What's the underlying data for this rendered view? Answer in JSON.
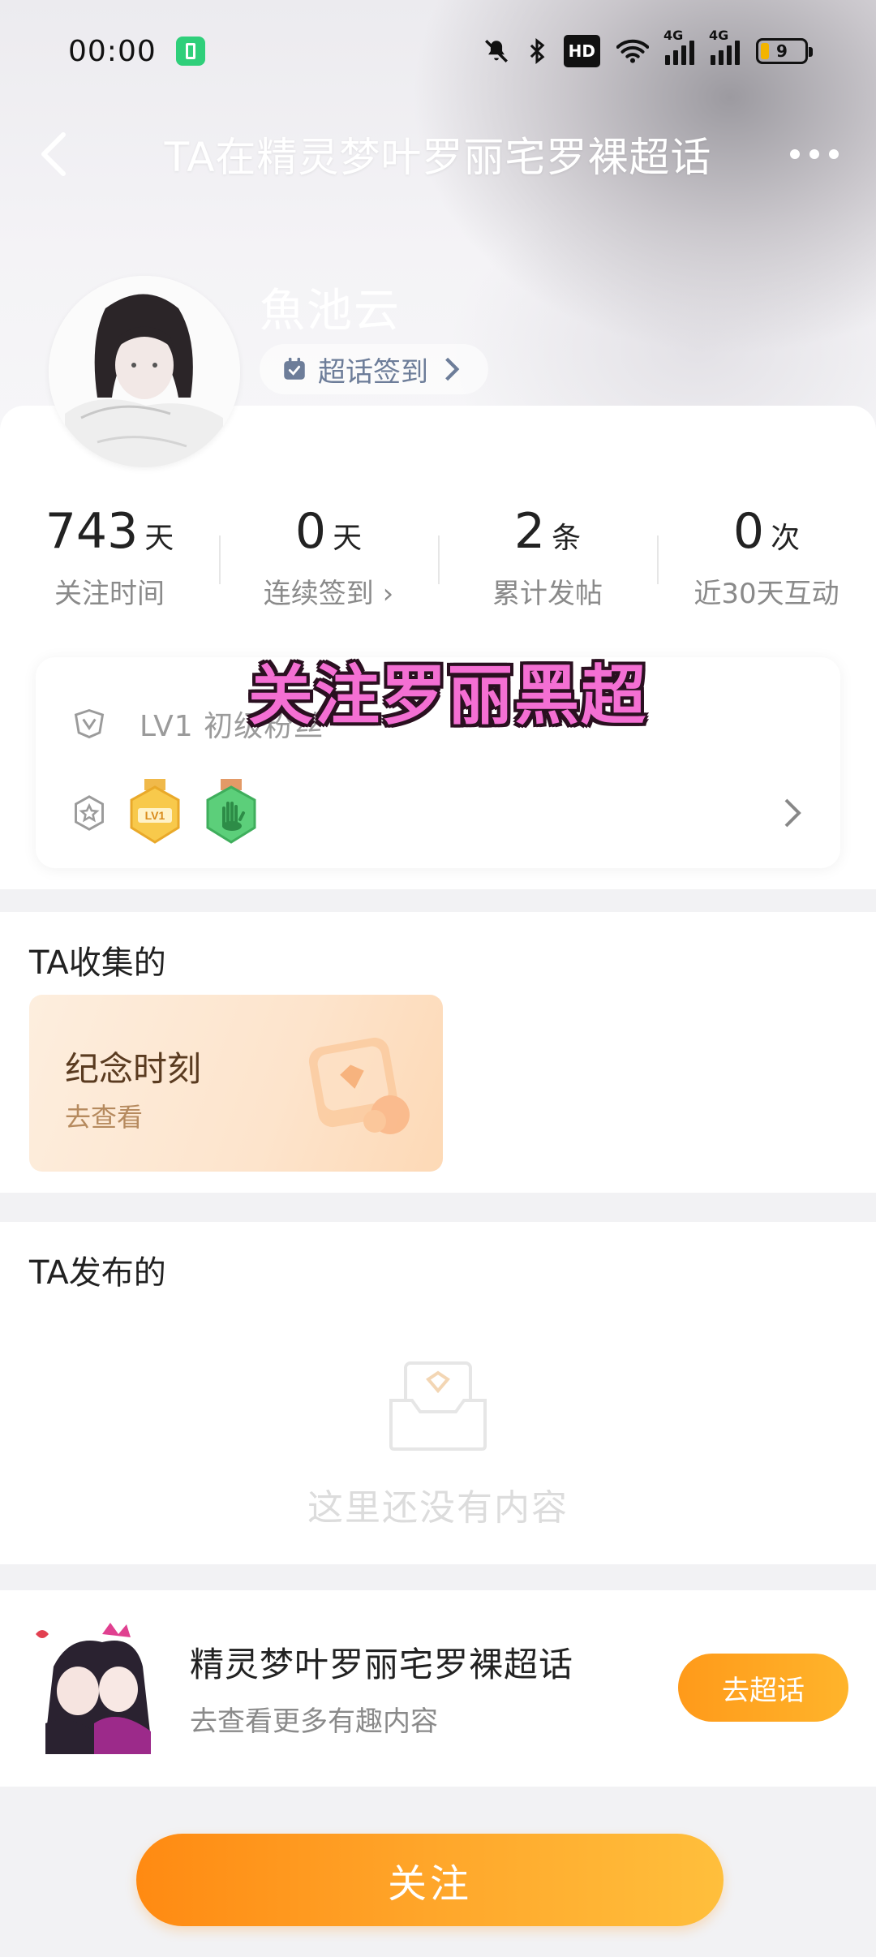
{
  "status_bar": {
    "time": "00:00",
    "hd_label": "HD",
    "network_1": "4G",
    "network_2": "4G",
    "battery_level": "9"
  },
  "nav": {
    "title": "TA在精灵梦叶罗丽宅罗裸超话"
  },
  "profile": {
    "username": "魚池云",
    "checkin_label": "超话签到"
  },
  "stats": [
    {
      "value": "743",
      "unit": "天",
      "label": "关注时间"
    },
    {
      "value": "0",
      "unit": "天",
      "label": "连续签到 ›"
    },
    {
      "value": "2",
      "unit": "条",
      "label": "累计发帖"
    },
    {
      "value": "0",
      "unit": "次",
      "label": "近30天互动"
    }
  ],
  "level": {
    "text": "LV1 初级粉丝",
    "badge_1_text": "LV1"
  },
  "overlay": {
    "text": "关注罗丽黑超"
  },
  "collected": {
    "section_title": "TA收集的",
    "card_title": "纪念时刻",
    "card_sub": "去查看"
  },
  "posted": {
    "section_title": "TA发布的",
    "empty_text": "这里还没有内容"
  },
  "topic": {
    "name": "精灵梦叶罗丽宅罗裸超话",
    "subtitle": "去查看更多有趣内容",
    "button": "去超话"
  },
  "bottom": {
    "follow_button": "关注"
  },
  "colors": {
    "accent_orange": "#ffa62a",
    "overlay_pink": "#f46fd3",
    "checkin_blue": "#6d7d99"
  }
}
